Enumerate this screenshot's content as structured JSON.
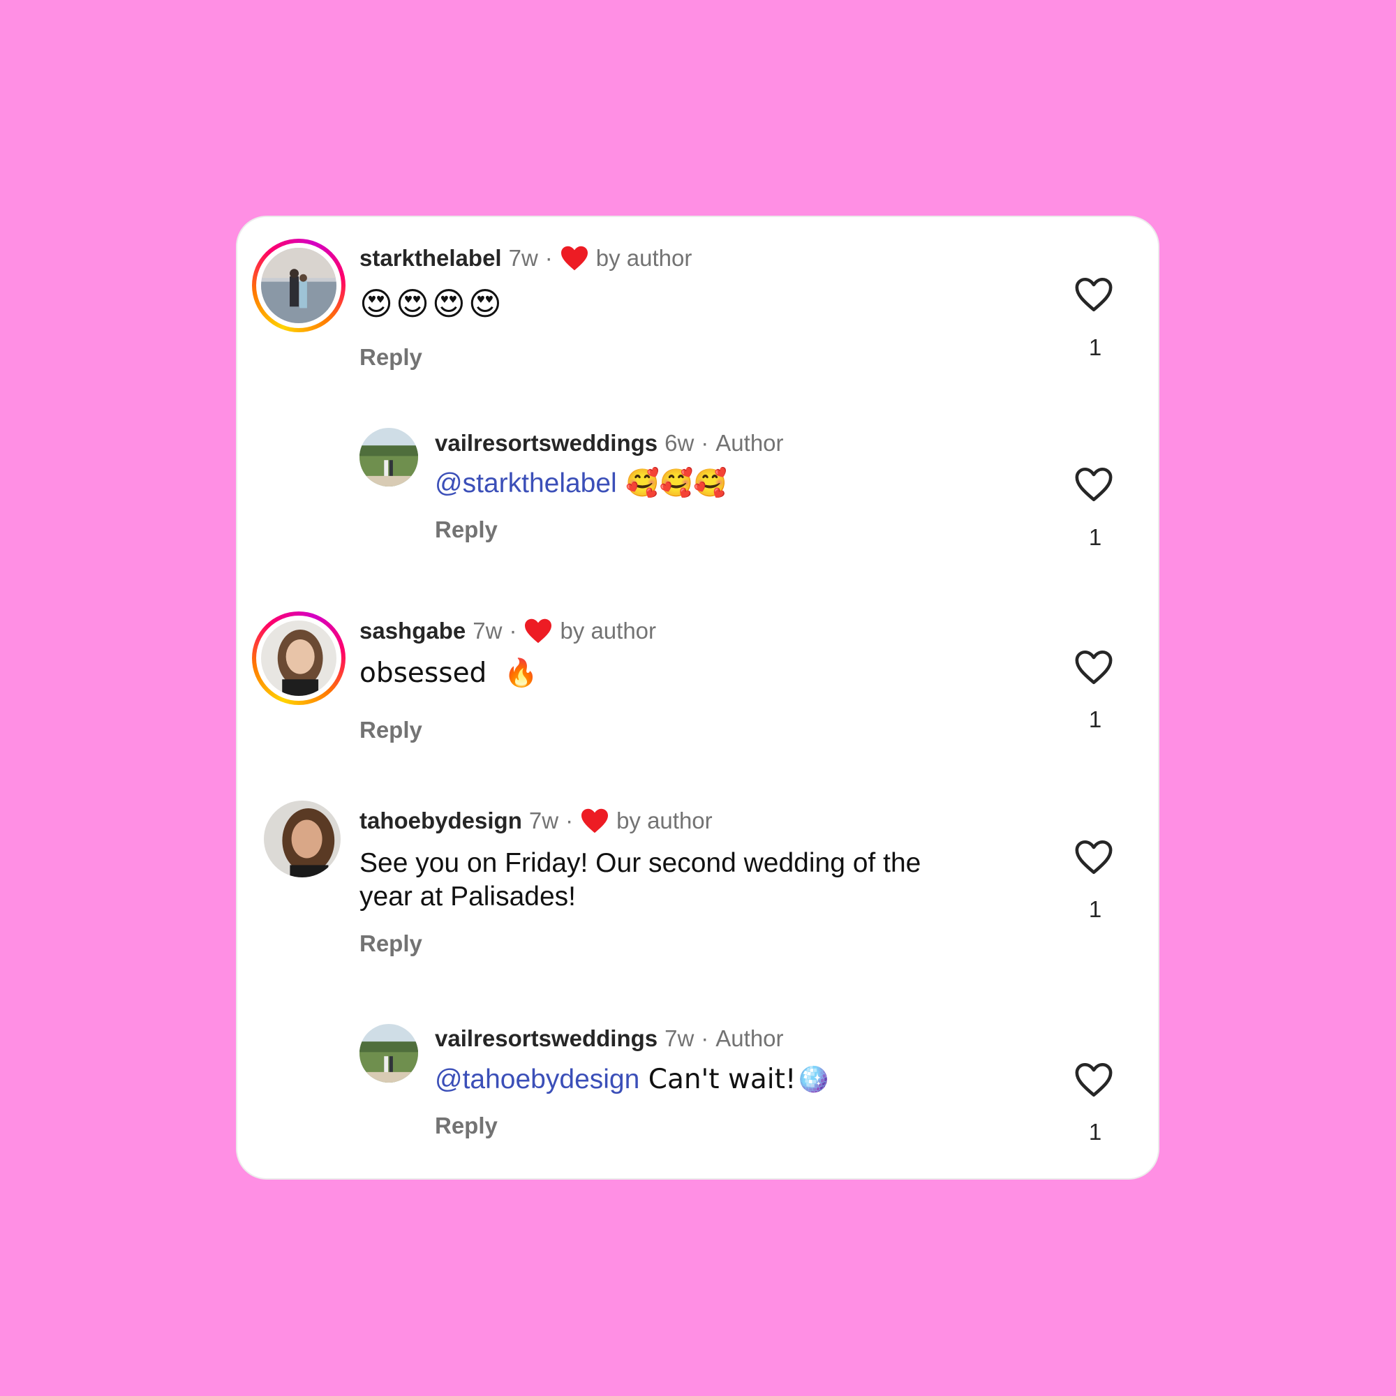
{
  "comments": [
    {
      "username": "starkthelabel",
      "time": "7w",
      "sep": "·",
      "badge": "by author",
      "text": "😍😍😍😍",
      "mention": "",
      "reply": "Reply",
      "likes": "1"
    },
    {
      "username": "vailresortsweddings",
      "time": "6w",
      "sep": "·",
      "badge": "Author",
      "mention": "@starkthelabel",
      "text": " 🥰🥰🥰",
      "reply": "Reply",
      "likes": "1"
    },
    {
      "username": "sashgabe",
      "time": "7w",
      "sep": "·",
      "badge": "by author",
      "mention": "",
      "text": "obsessed  🔥",
      "reply": "Reply",
      "likes": "1"
    },
    {
      "username": "tahoebydesign",
      "time": "7w",
      "sep": "·",
      "badge": "by author",
      "mention": "",
      "text_line1": "See you on Friday! Our second wedding of the",
      "text_line2": "year at Palisades!",
      "reply": "Reply",
      "likes": "1"
    },
    {
      "username": "vailresortsweddings",
      "time": "7w",
      "sep": "·",
      "badge": "Author",
      "mention": "@tahoebydesign",
      "text": " Can't wait!🪩",
      "reply": "Reply",
      "likes": "1"
    }
  ],
  "colors": {
    "background": "#ff8fe4",
    "mention": "#3b4fb8",
    "like_red": "#ed1c24"
  },
  "icons": {
    "like": "heart-outline-icon",
    "liked_by_author": "heart-filled-icon"
  }
}
